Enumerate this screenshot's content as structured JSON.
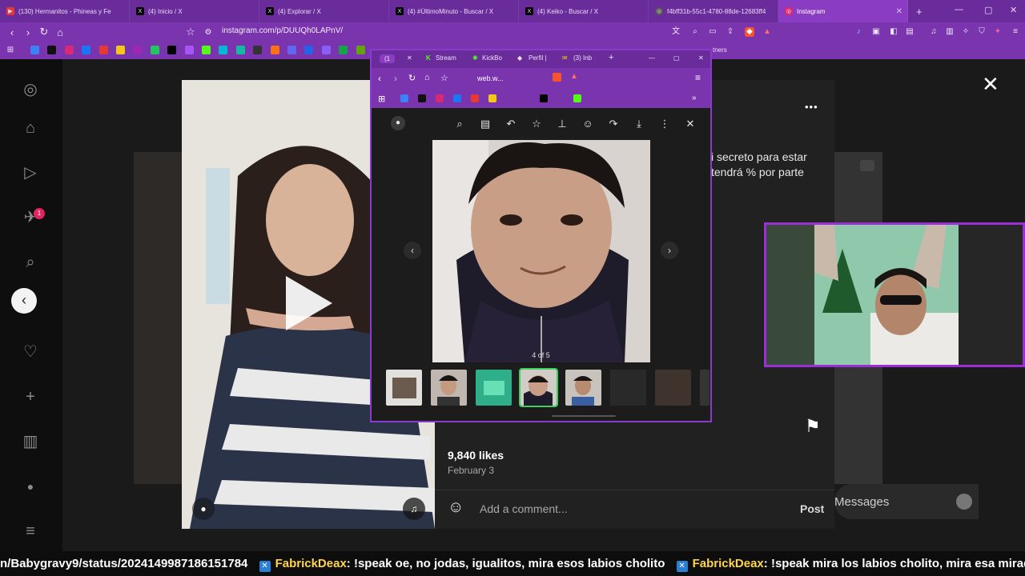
{
  "browser": {
    "tabs": [
      {
        "label": "(130) Hermanitos - Phineas y Fe",
        "icon": "youtube-icon",
        "color": "#e53935"
      },
      {
        "label": "(4) Inicio / X",
        "icon": "x-icon",
        "color": "#000000"
      },
      {
        "label": "(4) Explorar / X",
        "icon": "x-icon",
        "color": "#000000"
      },
      {
        "label": "(4) #ÚltimoMinuto - Buscar / X",
        "icon": "x-icon",
        "color": "#000000"
      },
      {
        "label": "(4) Keiko - Buscar / X",
        "icon": "x-icon",
        "color": "#000000"
      },
      {
        "label": "f4bff31b-55c1-4780-88de-12683ff4",
        "icon": "globe-icon",
        "color": "#6a6a6a"
      },
      {
        "label": "Instagram",
        "icon": "instagram-icon",
        "color": "#d62976"
      }
    ],
    "new_tab": "+",
    "url": "instagram.com/p/DUUQh0LAPnV/",
    "bookmarks_tail": "tners"
  },
  "popup": {
    "tabs": [
      "(1",
      "Stream",
      "KickBo",
      "Perfil |",
      "(3) Inb"
    ],
    "url": "web.w...",
    "counter": "4 of 5"
  },
  "post": {
    "caption_1": "i secreto para estar",
    "caption_2": "tendrá % por parte",
    "likes": "9,840 likes",
    "date": "February 3",
    "comment_placeholder": "Add a comment...",
    "post_label": "Post",
    "messages": "Messages",
    "more": "•••"
  },
  "notification_count": "1",
  "ticker": {
    "prefix": "n/Babygravy9/status/2024149987186151784",
    "messages": [
      {
        "user": "FabrickDeax",
        "text": ": !speak oe, no jodas, igualitos, mira esos labios cholito"
      },
      {
        "user": "FabrickDeax",
        "text": ": !speak mira los labios cholito, mira esa miradita"
      }
    ]
  },
  "colors": {
    "accent": "#7a35ae",
    "tab_active": "#8a3cc2",
    "selection": "#3ecf5e",
    "cam_border": "#9b2fd6"
  }
}
